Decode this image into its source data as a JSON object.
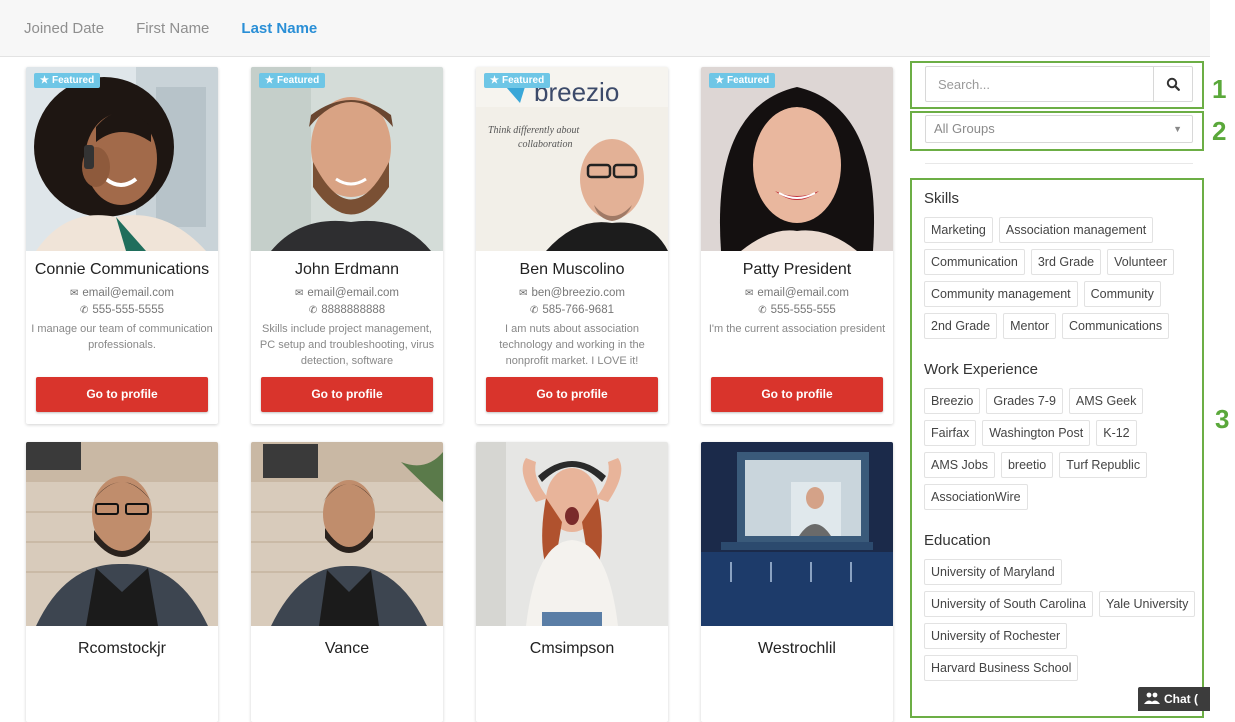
{
  "sort": {
    "options": [
      {
        "label": "Joined Date"
      },
      {
        "label": "First Name"
      },
      {
        "label": "Last Name"
      }
    ],
    "active_index": 2
  },
  "featured_label": "Featured",
  "members": [
    {
      "name": "Connie Communications",
      "email": "email@email.com",
      "phone": "555-555-5555",
      "bio": "I manage our team of communication professionals.",
      "featured": true
    },
    {
      "name": "John Erdmann",
      "email": "email@email.com",
      "phone": "8888888888",
      "bio": "Skills include project management, PC setup and troubleshooting, virus detection, software",
      "featured": true
    },
    {
      "name": "Ben Muscolino",
      "email": "ben@breezio.com",
      "phone": "585-766-9681",
      "bio": "I am nuts about association technology and working in the nonprofit market. I LOVE it!",
      "featured": true
    },
    {
      "name": "Patty President",
      "email": "email@email.com",
      "phone": "555-555-555",
      "bio": "I'm the current association president",
      "featured": true
    },
    {
      "name": "Rcomstockjr"
    },
    {
      "name": "Vance"
    },
    {
      "name": "Cmsimpson"
    },
    {
      "name": "Westrochlil"
    }
  ],
  "profile_button_label": "Go to profile",
  "photo_text": {
    "breezio_logo": "breezio",
    "breezio_tagline_1": "Think differently about",
    "breezio_tagline_2": "collaboration"
  },
  "search": {
    "placeholder": "Search...",
    "icon": "search-icon"
  },
  "group_filter": {
    "selected": "All Groups"
  },
  "facets": [
    {
      "title": "Skills",
      "tags": [
        "Marketing",
        "Association management",
        "Communication",
        "3rd Grade",
        "Volunteer",
        "Community management",
        "Community",
        "2nd Grade",
        "Mentor",
        "Communications"
      ]
    },
    {
      "title": "Work Experience",
      "tags": [
        "Breezio",
        "Grades 7-9",
        "AMS Geek",
        "Fairfax",
        "Washington Post",
        "K-12",
        "AMS Jobs",
        "breetio",
        "Turf Republic",
        "AssociationWire"
      ]
    },
    {
      "title": "Education",
      "tags": [
        "University of Maryland",
        "University of South Carolina",
        "Yale University",
        "University of Rochester",
        "Harvard Business School"
      ]
    }
  ],
  "callouts": [
    "1",
    "2",
    "3"
  ],
  "chat": {
    "label": "Chat ("
  },
  "colors": {
    "accent_blue": "#2a8fd6",
    "button_red": "#d9342c",
    "annotation_green": "#6cae45",
    "badge_blue": "#6ec6e6"
  }
}
